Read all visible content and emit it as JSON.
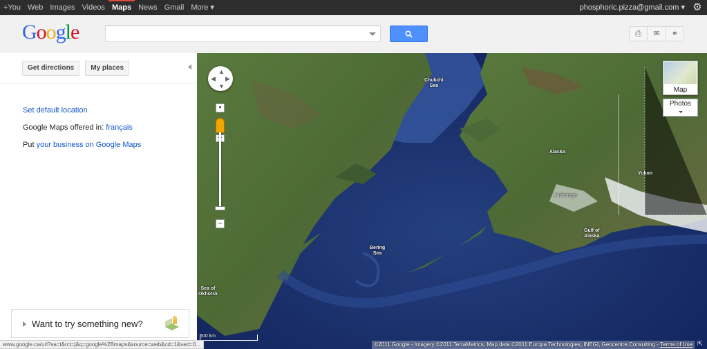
{
  "topbar": {
    "nav": [
      "+You",
      "Web",
      "Images",
      "Videos",
      "Maps",
      "News",
      "Gmail",
      "More ▾"
    ],
    "active": "Maps",
    "account": "phosphoric.pizza@gmail.com ▾"
  },
  "header": {
    "logo": [
      "G",
      "o",
      "o",
      "g",
      "l",
      "e"
    ],
    "search": {
      "value": "",
      "placeholder": ""
    },
    "search_icon": "search-icon",
    "tools": [
      "print-icon",
      "email-icon",
      "link-icon"
    ]
  },
  "sidebar": {
    "get_directions": "Get directions",
    "my_places": "My places",
    "set_default_location": "Set default location",
    "offered_in_prefix": "Google Maps offered in:",
    "offered_in_language": "français",
    "put_prefix": "Put",
    "put_link": "your business on Google Maps",
    "try_new": "Want to try something new?"
  },
  "map": {
    "labels": {
      "chukchi": "Chukchi\nSea",
      "alaska": "Alaska",
      "yukon": "Yukon",
      "anchorage": "Anchorage",
      "gulf": "Gulf of\nAlaska",
      "bering": "Bering\nSea",
      "okhotsk": "Sea of\nOkhotsk"
    },
    "map_type": "Map",
    "photos": "Photos",
    "scale": "500 km",
    "copyright": "©2011 Google - Imagery ©2011 TerraMetrics, Map data ©2011 Europa Technologies, INEGI, Geocentre Consulting -",
    "terms": "Terms of Use",
    "colors": {
      "ocean": "#1a2f6b",
      "land": "#4b6b3a",
      "snow": "#e8ecef"
    }
  },
  "status_url": "www.google.ca/url?sa=t&rct=j&q=google%2Bmaps&source=web&cd=1&ved=0..."
}
